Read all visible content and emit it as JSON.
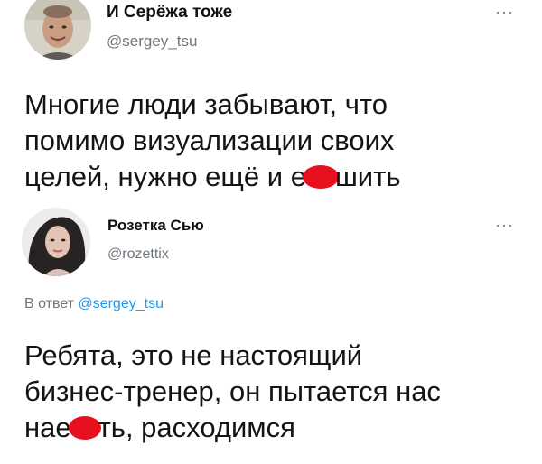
{
  "tweets": [
    {
      "author": {
        "name": "И Серёжа тоже",
        "handle": "@sergey_tsu"
      },
      "more_label": "···",
      "text_lines": [
        "Многие люди забывают, что",
        "помимо визуализации своих"
      ],
      "last_line": {
        "before": "целей, нужно ещё и е",
        "after": "шить"
      }
    },
    {
      "author": {
        "name": "Розетка Сью",
        "handle": "@rozettix"
      },
      "more_label": "···",
      "reply": {
        "prefix": "В ответ ",
        "handle": "@sergey_tsu"
      },
      "text_lines": [
        "Ребята, это не настоящий",
        "бизнес-тренер, он пытается нас"
      ],
      "last_line": {
        "before": "нае",
        "after": "ть, расходимся"
      }
    }
  ],
  "colors": {
    "censor_mark": "#e8101f",
    "handle_gray": "#6e767d",
    "link_blue": "#1d9bf0"
  }
}
